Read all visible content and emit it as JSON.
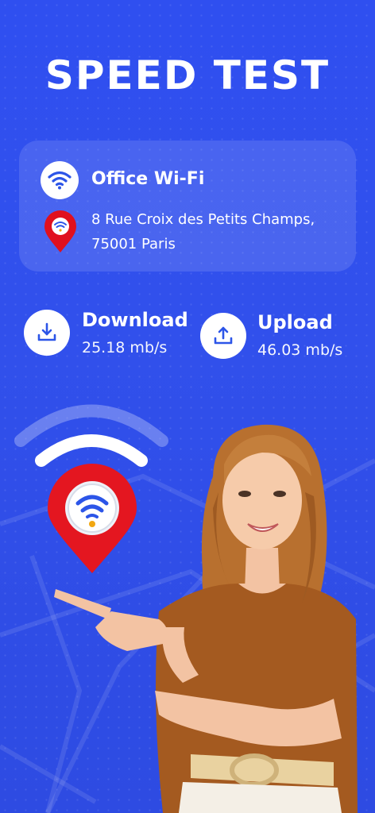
{
  "header": {
    "title": "SPEED TEST"
  },
  "network": {
    "name": "Office Wi-Fi",
    "address_line1": "8 Rue Croix des Petits Champs,",
    "address_line2": "75001 Paris"
  },
  "stats": {
    "download": {
      "label": "Download",
      "value": "25.18 mb/s"
    },
    "upload": {
      "label": "Upload",
      "value": "46.03 mb/s"
    }
  },
  "icons": {
    "wifi": "wifi-icon",
    "pin": "location-pin-icon",
    "download": "download-icon",
    "upload": "upload-icon"
  },
  "colors": {
    "background": "#2f4ff0",
    "pin_red": "#e0101e",
    "wifi_blue": "#2c55e8",
    "wifi_dot": "#f2a712"
  }
}
